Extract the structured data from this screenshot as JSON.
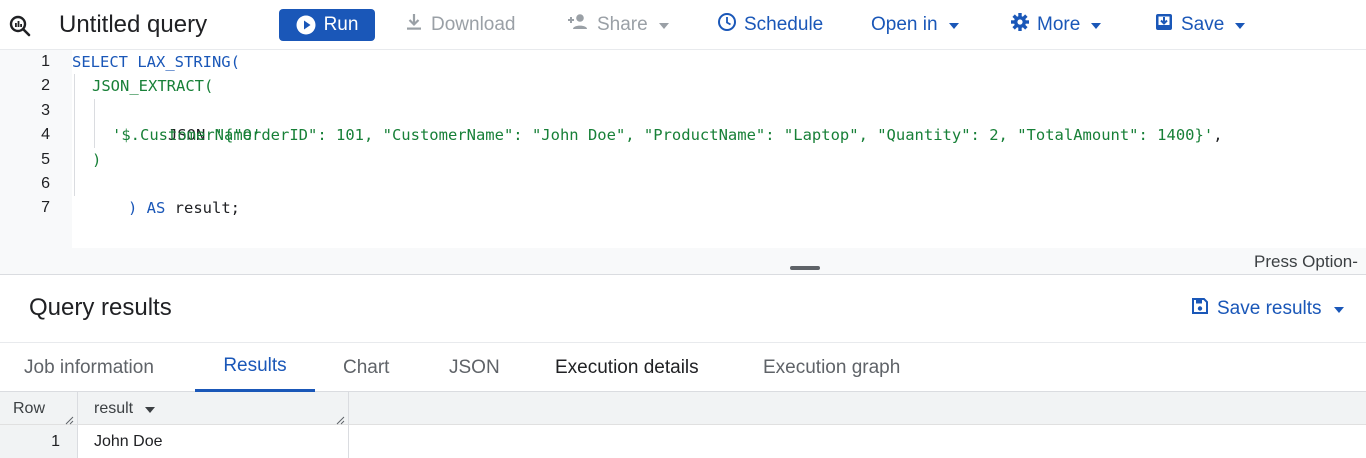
{
  "toolbar": {
    "title": "Untitled query",
    "run_label": "Run",
    "download_label": "Download",
    "share_label": "Share",
    "schedule_label": "Schedule",
    "open_in_label": "Open in",
    "more_label": "More",
    "save_label": "Save"
  },
  "editor": {
    "line_numbers": [
      "1",
      "2",
      "3",
      "4",
      "5",
      "6",
      "7"
    ],
    "lines": {
      "l1": "SELECT LAX_STRING(",
      "l2": "JSON_EXTRACT(",
      "l3_kw": "JSON ",
      "l3_str": "'{\"OrderID\": 101, \"CustomerName\": \"John Doe\", \"ProductName\": \"Laptop\", \"Quantity\": 2, \"TotalAmount\": 1400}'",
      "l3_end": ",",
      "l4": "'$.CustomerName'",
      "l5": ")",
      "l6_paren": ") ",
      "l6_kw": "AS",
      "l6_rest": " result;"
    },
    "hint": "Press Option-"
  },
  "results": {
    "title": "Query results",
    "save_results_label": "Save results",
    "tabs": [
      {
        "label": "Job information"
      },
      {
        "label": "Results"
      },
      {
        "label": "Chart"
      },
      {
        "label": "JSON"
      },
      {
        "label": "Execution details"
      },
      {
        "label": "Execution graph"
      }
    ],
    "active_tab": "Results",
    "table": {
      "headers": [
        "Row",
        "result"
      ],
      "rows": [
        {
          "num": "1",
          "result": "John Doe"
        }
      ]
    }
  },
  "colors": {
    "accent": "#1a57b8",
    "string": "#188038",
    "disabled": "#9aa0a6"
  }
}
